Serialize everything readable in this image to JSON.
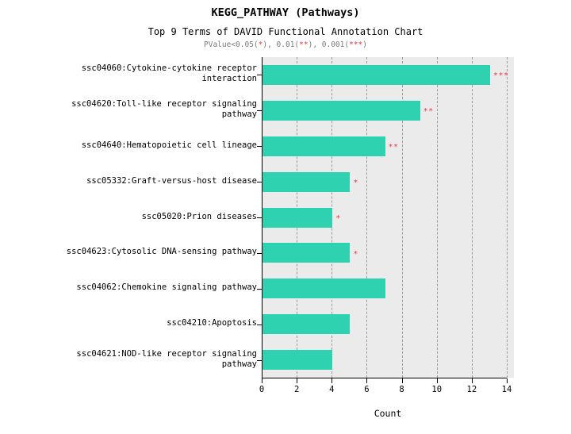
{
  "chart_data": {
    "type": "bar",
    "orientation": "horizontal",
    "title": "KEGG_PATHWAY (Pathways)",
    "subtitle": "Top 9 Terms of DAVID Functional Annotation Chart",
    "subtitle_note_parts": [
      {
        "text": "PValue<0.05(",
        "style": "plain"
      },
      {
        "text": "*",
        "style": "sig"
      },
      {
        "text": "), 0.01(",
        "style": "plain"
      },
      {
        "text": "**",
        "style": "sig"
      },
      {
        "text": "), 0.001(",
        "style": "plain"
      },
      {
        "text": "***",
        "style": "sig"
      },
      {
        "text": ")",
        "style": "plain"
      }
    ],
    "subtitle_note": "PValue<0.05(*), 0.01(**), 0.001(***)",
    "xlabel": "Count",
    "ylabel": "",
    "xlim": [
      0,
      14
    ],
    "xticks": [
      0,
      2,
      4,
      6,
      8,
      10,
      12,
      14
    ],
    "xtick_labels": [
      "0",
      "2",
      "4",
      "6",
      "8",
      "10",
      "12",
      "14"
    ],
    "grid": "vertical-dashed",
    "legend": "none",
    "bar_color": "#2ED2B0",
    "panel_color": "#EBEBEB",
    "significance_color": "#E8394A",
    "categories": [
      "ssc04060:Cytokine-cytokine receptor\ninteraction",
      "ssc04620:Toll-like receptor signaling\npathway",
      "ssc04640:Hematopoietic cell lineage",
      "ssc05332:Graft-versus-host disease",
      "ssc05020:Prion diseases",
      "ssc04623:Cytosolic DNA-sensing pathway",
      "ssc04062:Chemokine signaling pathway",
      "ssc04210:Apoptosis",
      "ssc04621:NOD-like receptor signaling\npathway"
    ],
    "values": [
      13,
      9,
      7,
      5,
      4,
      5,
      7,
      5,
      4
    ],
    "significance": [
      "***",
      "**",
      "**",
      "*",
      "*",
      "*",
      "",
      "",
      ""
    ]
  }
}
